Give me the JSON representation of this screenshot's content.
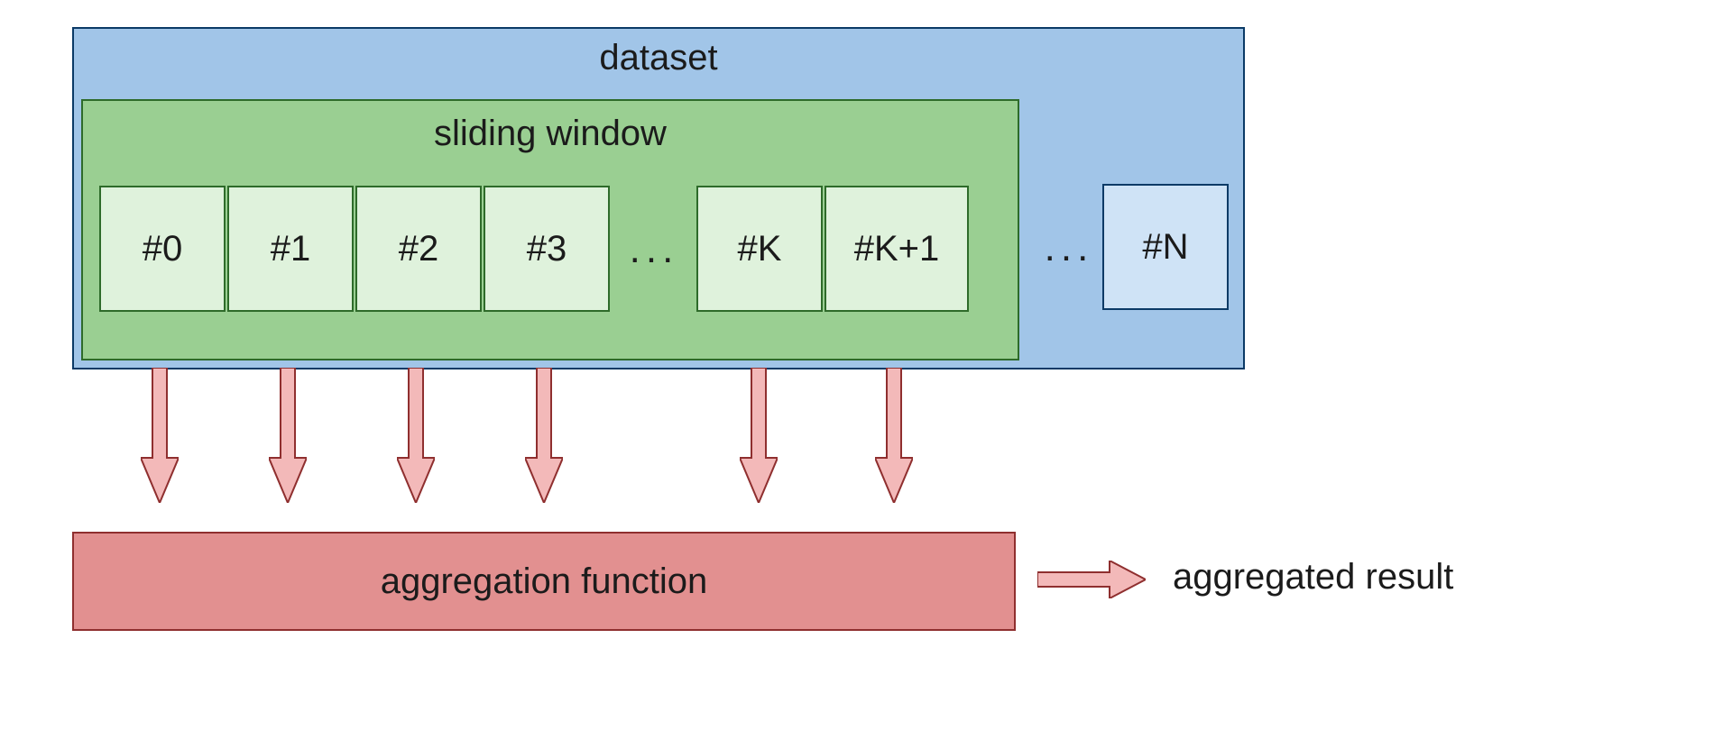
{
  "dataset": {
    "label": "dataset",
    "last_cell": "#N",
    "outer_ellipsis": "..."
  },
  "window": {
    "label": "sliding window",
    "cells": [
      "#0",
      "#1",
      "#2",
      "#3"
    ],
    "inner_ellipsis": "...",
    "tail_cells": [
      "#K",
      "#K+1"
    ]
  },
  "aggregation": {
    "label": "aggregation function",
    "result_label": "aggregated result"
  },
  "colors": {
    "dataset_bg": "#a1c5e8",
    "window_bg": "#9acf92",
    "cell_green": "#dff2dc",
    "cell_blue": "#cfe3f6",
    "agg_bg": "#e29090",
    "arrow_fill": "#f3b9b9",
    "arrow_stroke": "#8f2f2f"
  }
}
